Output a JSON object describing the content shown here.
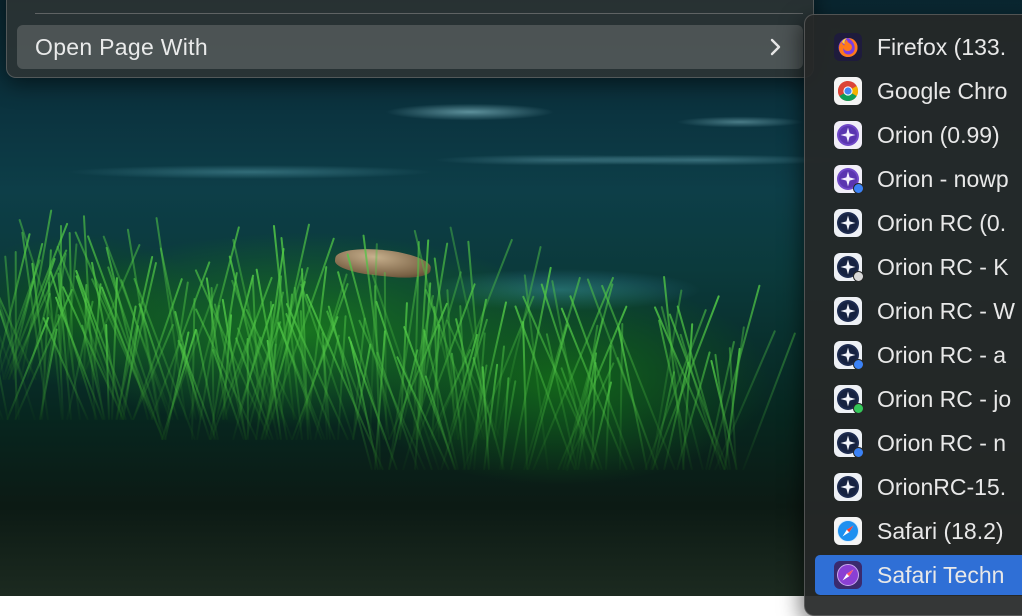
{
  "parent_menu": {
    "item_label": "Open Page With",
    "chevron_icon": "chevron-right-icon"
  },
  "submenu": {
    "items": [
      {
        "label": "Firefox (133.",
        "icon": "firefox-icon",
        "badge": null,
        "selected": false
      },
      {
        "label": "Google Chro",
        "icon": "google-chrome-icon",
        "badge": null,
        "selected": false
      },
      {
        "label": "Orion (0.99)",
        "icon": "orion-icon",
        "badge": null,
        "selected": false
      },
      {
        "label": "Orion - nowp",
        "icon": "orion-icon",
        "badge": "#3b82f6",
        "selected": false
      },
      {
        "label": "Orion RC (0.",
        "icon": "orion-rc-icon",
        "badge": null,
        "selected": false
      },
      {
        "label": "Orion RC - K",
        "icon": "orion-rc-icon",
        "badge": "#d9d9d9",
        "selected": false
      },
      {
        "label": "Orion RC - W",
        "icon": "orion-rc-icon",
        "badge": null,
        "selected": false
      },
      {
        "label": "Orion RC - a",
        "icon": "orion-rc-icon",
        "badge": "#3b82f6",
        "selected": false
      },
      {
        "label": "Orion RC - jo",
        "icon": "orion-rc-icon",
        "badge": "#34c759",
        "selected": false
      },
      {
        "label": "Orion RC - n",
        "icon": "orion-rc-icon",
        "badge": "#3b82f6",
        "selected": false
      },
      {
        "label": "OrionRC-15.",
        "icon": "orion-rc-icon",
        "badge": null,
        "selected": false
      },
      {
        "label": "Safari (18.2)",
        "icon": "safari-icon",
        "badge": null,
        "selected": false
      },
      {
        "label": "Safari Techn",
        "icon": "safari-technology-preview-icon",
        "badge": null,
        "selected": true
      }
    ]
  },
  "colors": {
    "selection": "#2f6fd6",
    "menu_background": "#262828",
    "text": "#e8e8e8"
  }
}
